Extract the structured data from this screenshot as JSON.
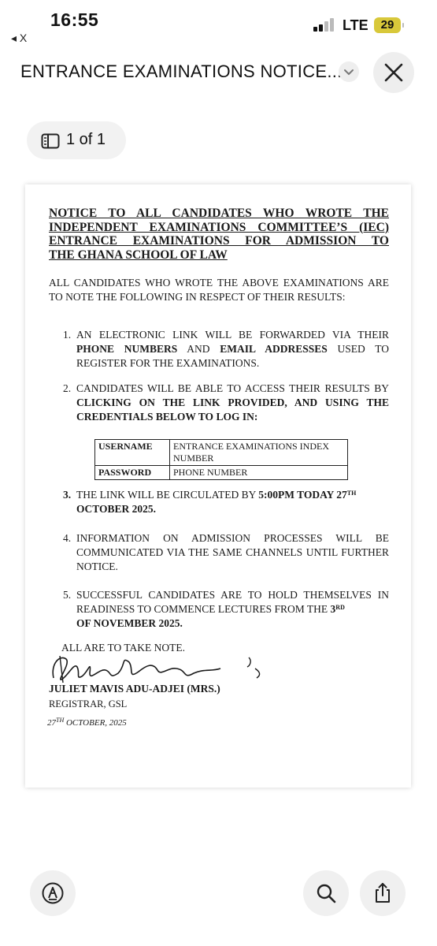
{
  "status_bar": {
    "time": "16:55",
    "network": "LTE",
    "battery": "29",
    "back_label": "◂ X"
  },
  "header": {
    "title": "ENTRANCE EXAMINATIONS NOTICE..."
  },
  "pager": {
    "label": "1 of 1"
  },
  "document": {
    "heading_lines": [
      "NOTICE TO ALL CANDIDATES WHO WROTE THE",
      "INDEPENDENT EXAMINATIONS COMMITTEE’S (IEC)",
      "ENTRANCE EXAMINATIONS FOR ADMISSION TO",
      "THE GHANA SCHOOL OF LAW"
    ],
    "intro": "ALL CANDIDATES WHO WROTE THE ABOVE EXAMINATIONS ARE TO NOTE THE FOLLOWING IN RESPECT OF THEIR RESULTS:",
    "items": [
      {
        "num": "1.",
        "a": "AN ELECTRONIC LINK WILL BE FORWARDED VIA THEIR ",
        "b1": "PHONE NUMBERS",
        "c": " AND ",
        "b2": "EMAIL ADDRESSES",
        "d": " USED TO REGISTER FOR THE EXAMINATIONS."
      },
      {
        "num": "2.",
        "a": "CANDIDATES WILL BE ABLE TO ACCESS THEIR RESULTS BY ",
        "b1": "CLICKING ON THE LINK PROVIDED, AND USING THE CREDENTIALS BELOW TO LOG IN:"
      },
      {
        "num": "3.",
        "a": "THE LINK WILL BE CIRCULATED BY ",
        "b1": "5:00PM TODAY 27",
        "sup": "TH",
        "b2": "OCTOBER 2025."
      },
      {
        "num": "4.",
        "a": "INFORMATION ON ADMISSION PROCESSES WILL BE COMMUNICATED VIA THE SAME CHANNELS UNTIL FURTHER NOTICE."
      },
      {
        "num": "5.",
        "a": "SUCCESSFUL CANDIDATES ARE TO HOLD THEMSELVES IN READINESS TO COMMENCE LECTURES FROM THE ",
        "b1": "3",
        "sup": "RD",
        "b2": "OF NOVEMBER 2025."
      }
    ],
    "credentials": [
      {
        "key": "USERNAME",
        "value": "ENTRANCE EXAMINATIONS INDEX NUMBER"
      },
      {
        "key": "PASSWORD",
        "value": "PHONE NUMBER"
      }
    ],
    "closing": "ALL ARE TO TAKE NOTE.",
    "signatory": "JULIET MAVIS ADU-ADJEI (MRS.)",
    "role": "REGISTRAR, GSL",
    "date_day": "27",
    "date_sup": "TH",
    "date_rest": " OCTOBER, 2025"
  },
  "toolbar": {
    "markup_icon": "markup-icon",
    "search_icon": "search-icon",
    "share_icon": "share-icon"
  }
}
